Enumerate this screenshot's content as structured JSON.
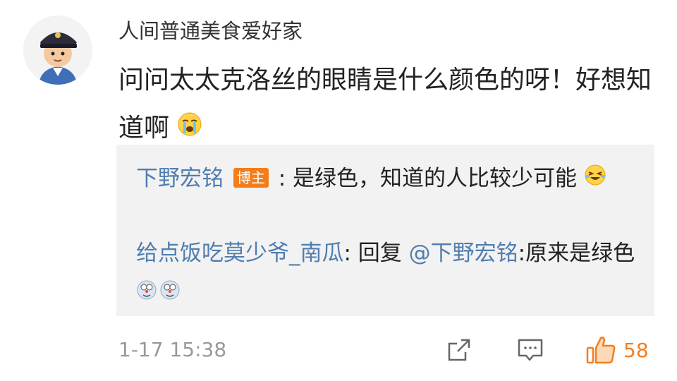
{
  "comment": {
    "username": "人间普通美食爱好家",
    "text": "问问太太克洛丝的眼睛是什么颜色的呀！好想知道啊",
    "text_emoji": "crying-face-emoji"
  },
  "replies": [
    {
      "author": "下野宏铭",
      "badge": "博主",
      "text": ": 是绿色，知道的人比较少可能",
      "emoji": "laughing-tears-emoji"
    },
    {
      "author": "给点饭吃莫少爷_南瓜",
      "reply_prefix": ": 回复 ",
      "mention": "@下野宏铭",
      "text": ":原来是绿色",
      "emoji": "doraemon-face-emoji"
    }
  ],
  "footer": {
    "timestamp": "1-17 15:38",
    "share_icon": "share-icon",
    "comment_icon": "comment-icon",
    "like_icon": "thumbs-up-icon",
    "like_count": "58",
    "like_color": "#f57d19"
  }
}
